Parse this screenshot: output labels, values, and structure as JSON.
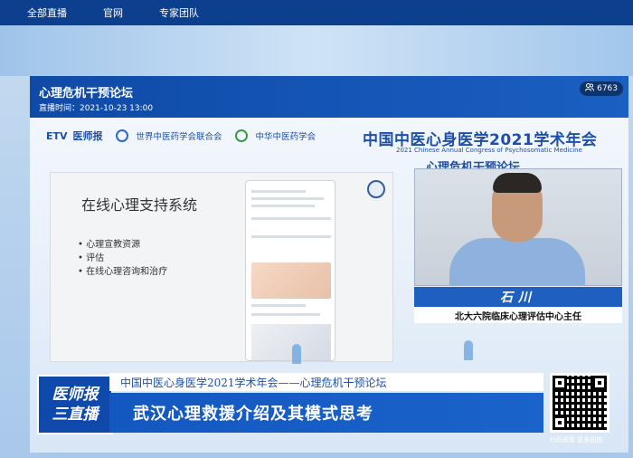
{
  "nav": {
    "items": [
      "全部直播",
      "官网",
      "专家团队"
    ]
  },
  "player": {
    "title": "心理危机干预论坛",
    "time": "直播时间：2021-10-23 13:00",
    "viewers": "6763"
  },
  "video": {
    "logos": {
      "etv": "ETV",
      "yishibao": "医师报",
      "wfcms": "世界中医药学会联合会",
      "cacm": "中华中医药学会"
    },
    "congress_cn": "中国中医心身医学2021学术年会",
    "congress_en": "2021 Chinese Annual Congress of Psychosomatic Medicine",
    "forum": "心理危机干预论坛",
    "slide": {
      "title": "在线心理支持系统",
      "bullets": [
        "心理宣教资源",
        "评估",
        "在线心理咨询和治疗"
      ]
    },
    "speaker": {
      "name": "石川",
      "role": "北大六院临床心理评估中心主任"
    },
    "lower_third": {
      "badge_line1": "医师报",
      "badge_line2": "三直播",
      "subtitle": "中国中医心身医学2021学术年会——心理危机干预论坛",
      "main": "武汉心理救援介绍及其模式思考",
      "qr_caption": "扫码观看 更多回放"
    }
  }
}
